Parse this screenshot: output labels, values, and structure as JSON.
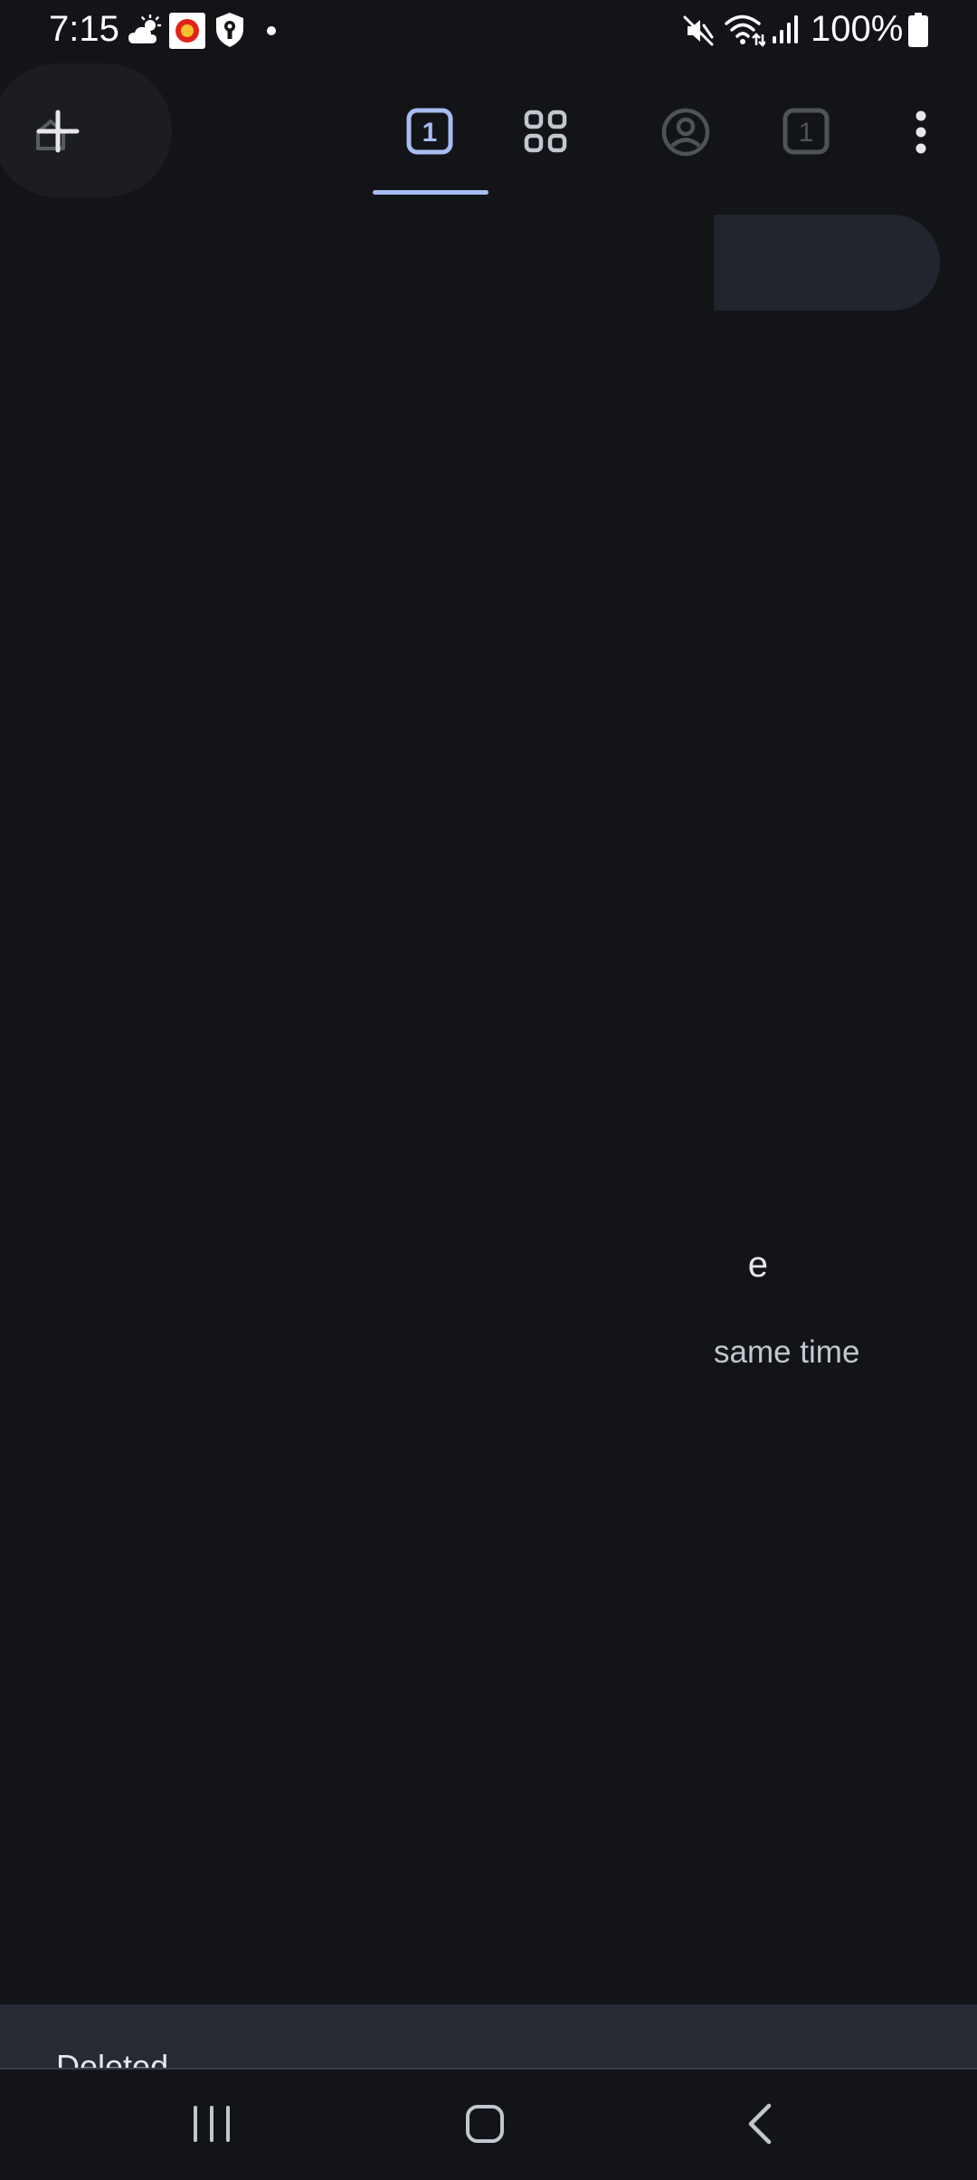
{
  "status_bar": {
    "time": "7:15",
    "battery": "100%",
    "icons": [
      "weather-cloud-sun-icon",
      "app-notification-icon",
      "shield-lock-icon",
      "dot-icon",
      "mute-icon",
      "wifi-icon",
      "signal-icon",
      "battery-icon"
    ]
  },
  "toolbar": {
    "incognito_tab_count": "1",
    "regular_tab_count": "1",
    "icons": [
      "new-tab-icon",
      "tab-grid-icon",
      "account-icon",
      "more-vert-icon"
    ]
  },
  "main": {
    "empty_heading_fragment": "e",
    "empty_body_fragment": "same time"
  },
  "snackbar": {
    "message": "Deleted"
  },
  "navigation": {
    "icons": [
      "recents-icon",
      "home-icon",
      "back-icon"
    ]
  },
  "colors": {
    "background": "#131418",
    "accent": "#a7bdf2",
    "surface": "#22252d"
  }
}
